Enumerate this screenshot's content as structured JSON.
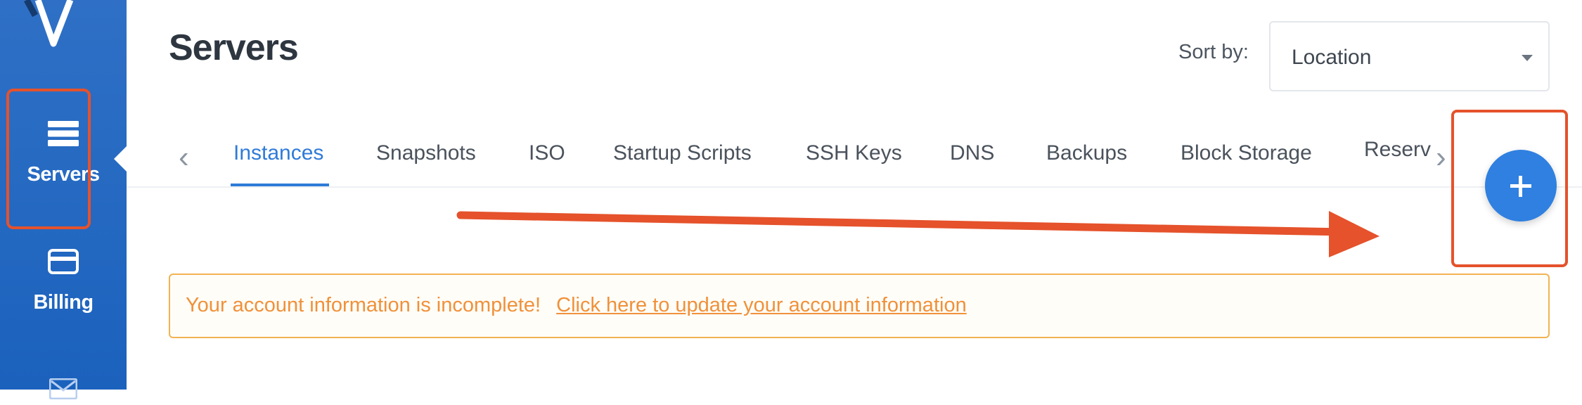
{
  "sidebar": {
    "logo_icon": "vultr-v-logo",
    "items": [
      {
        "label": "Servers",
        "icon": "server-stack-icon",
        "active": true
      },
      {
        "label": "Billing",
        "icon": "credit-card-icon",
        "active": false
      },
      {
        "label": "",
        "icon": "mail-icon",
        "active": false
      }
    ]
  },
  "header": {
    "title": "Servers",
    "sort_label": "Sort by:",
    "sort_value": "Location"
  },
  "tabs": [
    {
      "label": "Instances",
      "active": true
    },
    {
      "label": "Snapshots"
    },
    {
      "label": "ISO"
    },
    {
      "label": "Startup Scripts"
    },
    {
      "label": "SSH Keys"
    },
    {
      "label": "DNS"
    },
    {
      "label": "Backups"
    },
    {
      "label": "Block Storage"
    },
    {
      "label": "Reserv"
    }
  ],
  "add_button": {
    "icon": "plus-icon"
  },
  "alert": {
    "message": "Your account information is incomplete!",
    "link_text": "Click here to update your account information"
  },
  "colors": {
    "sidebar": "#2f70c6",
    "accent": "#2f7bd8",
    "annotation": "#e5522b",
    "warning": "#f0913a"
  }
}
